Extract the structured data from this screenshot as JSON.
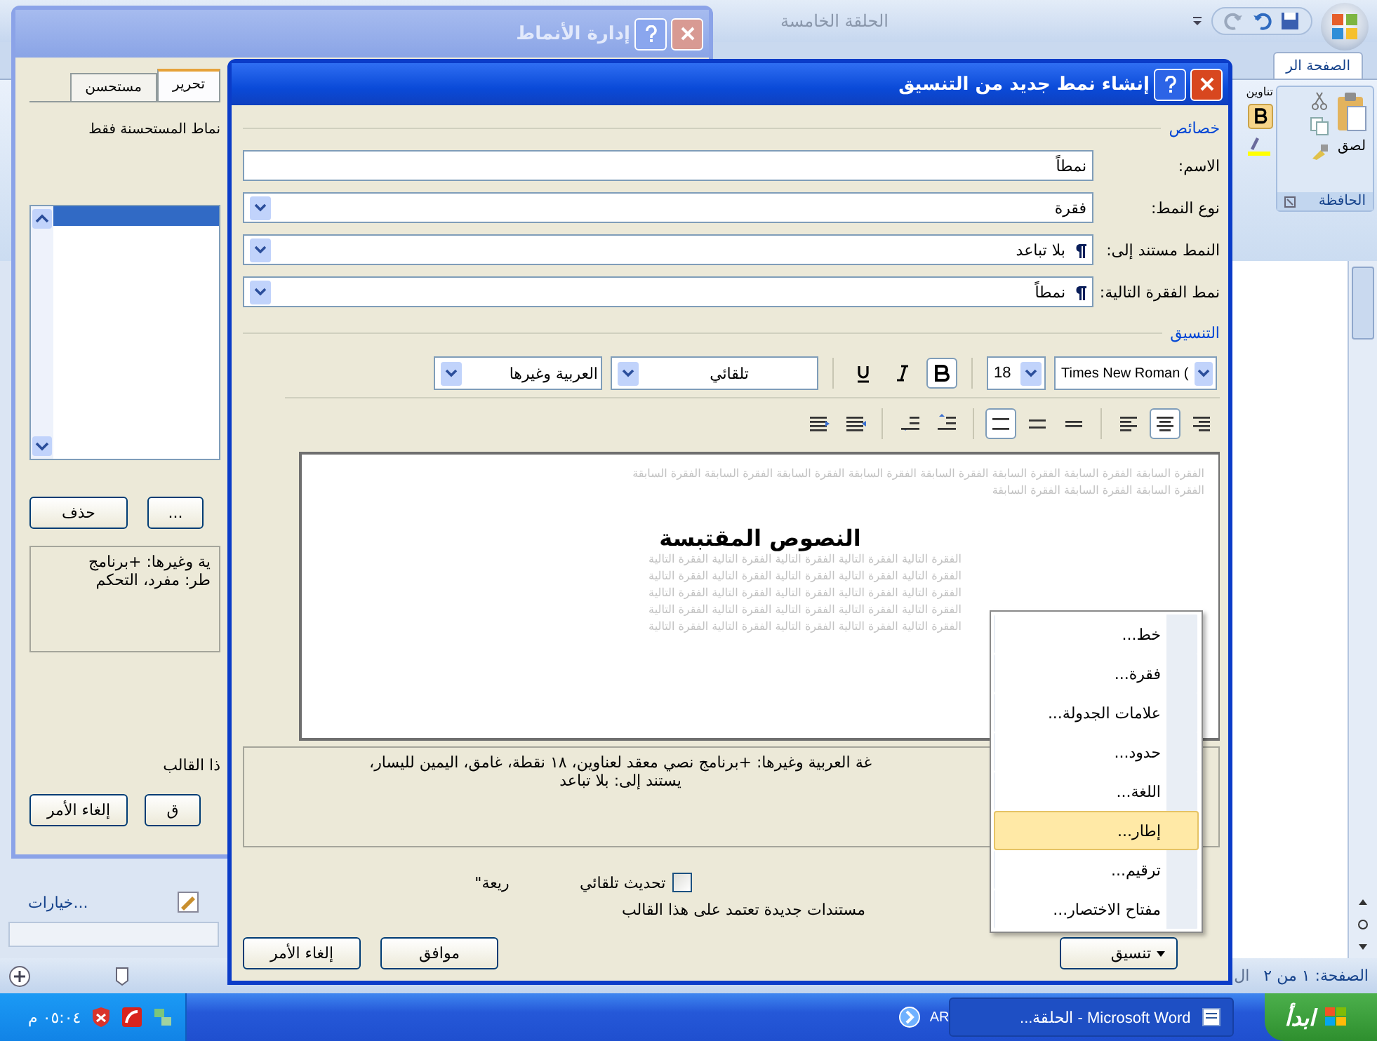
{
  "word": {
    "title": "الحلقة الخامسة",
    "ribbon_tab": "الصفحة الر",
    "partial_group": "تناوين",
    "paste_label": "لصق",
    "clipboard_group": "الحافظة",
    "styles_pane_link": "خيارات...",
    "status_partial": "ال",
    "status_page": "الصفحة: ١ من ٢"
  },
  "manage_styles": {
    "title": "إدارة الأنماط",
    "tabs": [
      {
        "label": "تحرير",
        "selected": true
      },
      {
        "label": "مستحسن",
        "selected": false
      }
    ],
    "filter_text": "نماط المستحسنة فقط",
    "delete_button": "حذف",
    "more_button": "...",
    "description_lines": [
      "ية وغيرها: +برنامج",
      "طر: مفرد، التحكم"
    ],
    "template_text": "ذا القالب",
    "cancel_button": "إلغاء الأمر",
    "ok_button": "ق"
  },
  "dialog": {
    "title": "إنشاء نمط جديد من التنسيق",
    "properties_header": "خصائص",
    "fields": [
      {
        "label": "الاسم:",
        "value": "نمطاً",
        "kind": "text"
      },
      {
        "label": "نوع النمط:",
        "value": "فقرة",
        "kind": "combo"
      },
      {
        "label": "النمط مستند إلى:",
        "value": "بلا تباعد",
        "kind": "paragraph"
      },
      {
        "label": "نمط الفقرة التالية:",
        "value": "نمطاً",
        "kind": "paragraph"
      }
    ],
    "formatting_header": "التنسيق",
    "font": "Times New Roman (",
    "size": "18",
    "bold": true,
    "italic": false,
    "underline": false,
    "font_color_option": "تلقائي",
    "script": "العربية وغيرها",
    "alignment": [
      {
        "kind": "right",
        "selected": false
      },
      {
        "kind": "center",
        "selected": true
      },
      {
        "kind": "left",
        "selected": false
      }
    ],
    "line_spacing": [
      {
        "kind": "single",
        "selected": false
      },
      {
        "kind": "one-half",
        "selected": false
      },
      {
        "kind": "double",
        "selected": true
      }
    ],
    "preview": {
      "previous_lines": [
        "الفقرة السابقة الفقرة السابقة الفقرة السابقة الفقرة السابقة الفقرة السابقة الفقرة السابقة الفقرة السابقة الفقرة السابقة",
        "الفقرة السابقة الفقرة السابقة الفقرة السابقة"
      ],
      "sample": "النصوص المقتبسة",
      "following_lines": [
        "الفقرة التالية الفقرة التالية الفقرة التالية الفقرة التالية الفقرة التالية",
        "الفقرة التالية الفقرة التالية الفقرة التالية الفقرة التالية الفقرة التالية",
        "الفقرة التالية الفقرة التالية الفقرة التالية الفقرة التالية الفقرة التالية",
        "الفقرة التالية الفقرة التالية الفقرة التالية الفقرة التالية الفقرة التالية",
        "الفقرة التالية الفقرة التالية الفقرة التالية الفقرة التالية الفقرة التالية"
      ]
    },
    "description_lines": [
      "غة العربية وغيرها: +برنامج نصي معقد لعناوين، ١٨ نقطة، غامق، اليمين لليسار،",
      "يستند إلى: بلا تباعد"
    ],
    "quick_style_partial": "ريعة\"",
    "auto_update": {
      "label": "تحديث تلقائي",
      "checked": false
    },
    "template_line": "مستندات جديدة تعتمد على هذا القالب",
    "format_button": "تنسيق",
    "ok_button": "موافق",
    "cancel_button": "إلغاء الأمر"
  },
  "format_menu": [
    {
      "label": "خط...",
      "selected": false
    },
    {
      "label": "فقرة...",
      "selected": false
    },
    {
      "label": "علامات الجدولة...",
      "selected": false
    },
    {
      "label": "حدود...",
      "selected": false
    },
    {
      "label": "اللغة...",
      "selected": false
    },
    {
      "label": "إطار...",
      "selected": true
    },
    {
      "label": "ترقيم...",
      "selected": false
    },
    {
      "label": "مفتاح الاختصار...",
      "selected": false
    }
  ],
  "taskbar": {
    "start": "ابدأ",
    "task": "Microsoft Word - الحلقة...",
    "language": "AR",
    "clock": "٠٥:٠٤ م"
  }
}
